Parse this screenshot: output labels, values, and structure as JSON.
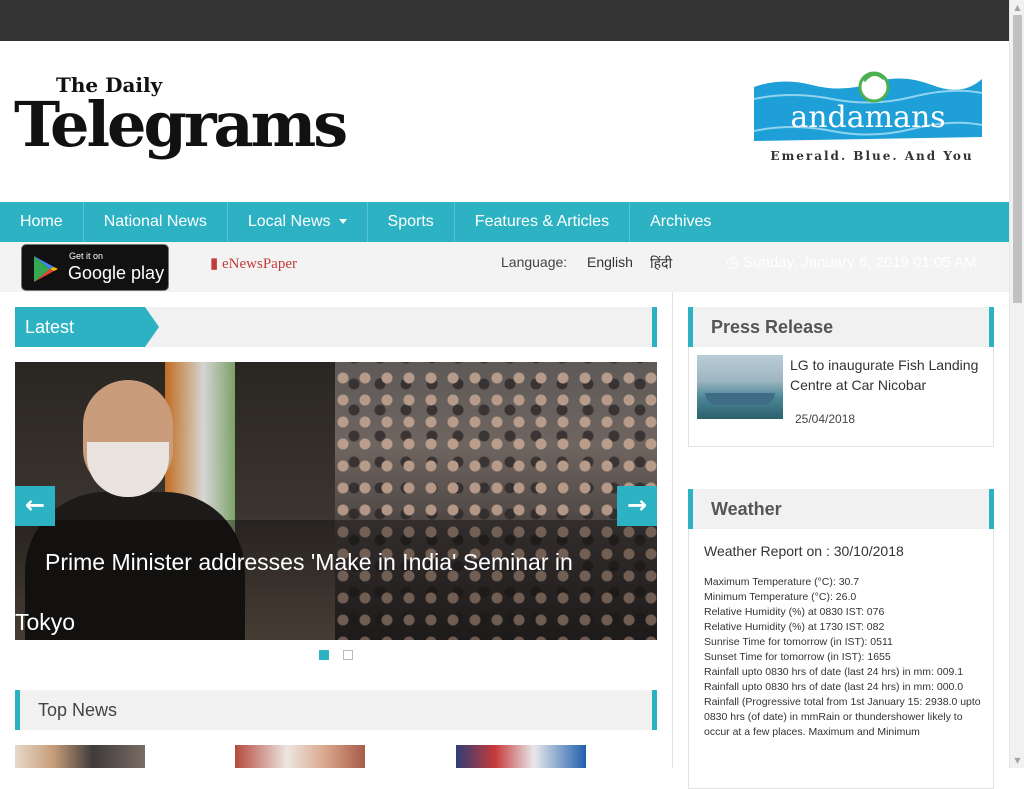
{
  "header": {
    "logo_the_daily": "The Daily",
    "logo_telegrams": "Telegrams",
    "andamans_word": "andamans",
    "andamans_tagline": "Emerald. Blue. And You"
  },
  "nav": {
    "items": [
      "Home",
      "National News",
      "Local News",
      "Sports",
      "Features & Articles",
      "Archives"
    ]
  },
  "subbar": {
    "gplay_small": "Get it on",
    "gplay_big": "Google play",
    "enewspaper": "eNewsPaper",
    "language_label": "Language:",
    "lang_english": "English",
    "lang_hindi": "हिंदी",
    "date": "Sunday, January 6, 2019 01:05 AM"
  },
  "latest": {
    "title": "Latest",
    "caption": "Prime Minister addresses 'Make in India' Seminar in Tokyo",
    "prev": "←",
    "next": "→"
  },
  "top_news": {
    "title": "Top News"
  },
  "press_release": {
    "title": "Press Release",
    "item_title": "LG to inaugurate Fish Landing Centre at Car Nicobar",
    "item_date": "25/04/2018"
  },
  "weather": {
    "title": "Weather",
    "report_label": "Weather Report on : 30/10/2018",
    "lines": [
      "Maximum Temperature (°C): 30.7",
      "Minimum Temperature (°C): 26.0",
      "Relative Humidity (%) at 0830 IST: 076",
      "Relative Humidity (%) at 1730 IST: 082",
      "Sunrise Time for tomorrow (in IST): 0511",
      "Sunset Time for tomorrow (in IST): 1655",
      "Rainfall upto 0830 hrs of date (last 24 hrs) in mm: 009.1",
      "Rainfall upto 0830 hrs of date (last 24 hrs) in mm: 000.0",
      "Rainfall (Progressive total from 1st January 15: 2938.0 upto 0830 hrs (of date) in mmRain or thundershower likely to occur at a few places. Maximum and Minimum"
    ]
  },
  "colors": {
    "accent": "#2db2c3",
    "topbar": "#333333",
    "enews": "#c43b3b"
  }
}
